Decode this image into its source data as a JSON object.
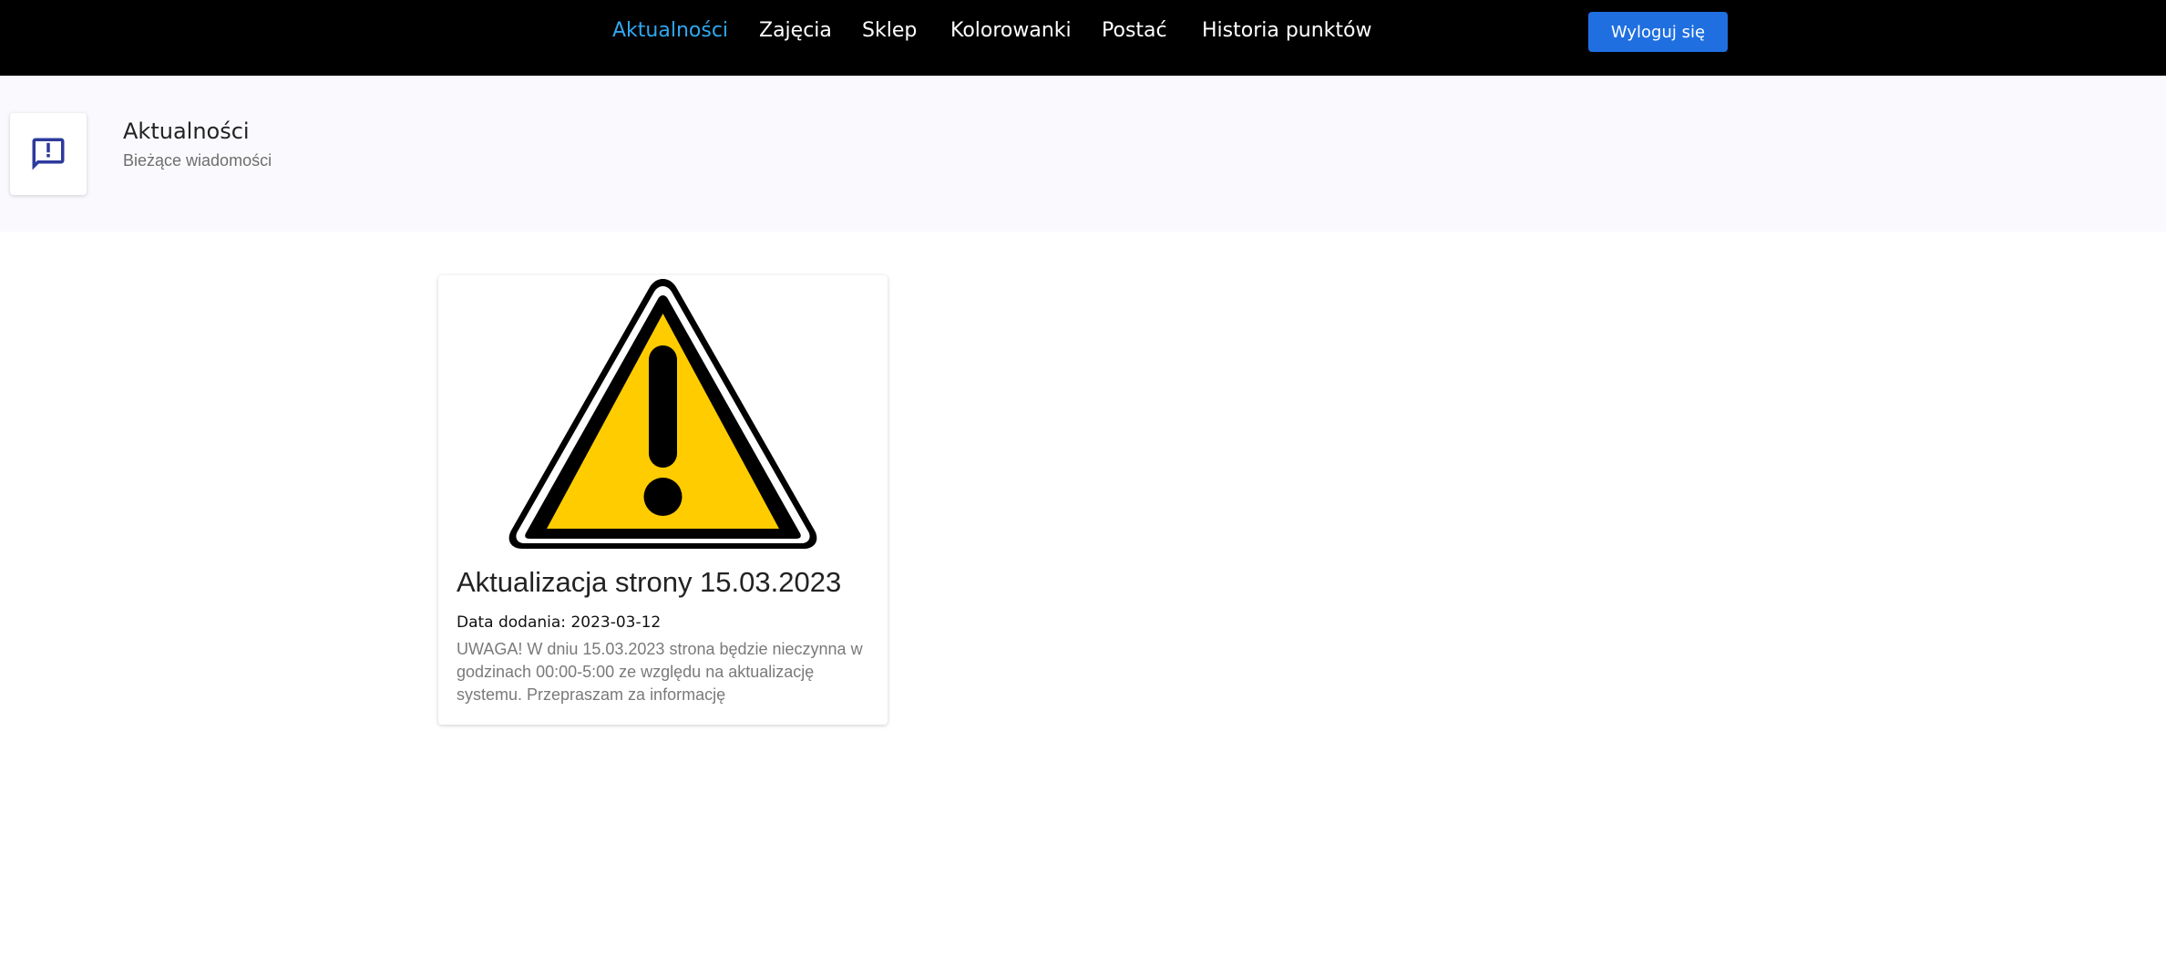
{
  "nav": {
    "items": [
      {
        "label": "Aktualności",
        "active": true
      },
      {
        "label": "Zajęcia",
        "active": false
      },
      {
        "label": "Sklep",
        "active": false
      },
      {
        "label": "Kolorowanki",
        "active": false
      },
      {
        "label": "Postać",
        "active": false
      },
      {
        "label": "Historia punktów",
        "active": false
      }
    ],
    "logout_label": "Wyloguj się"
  },
  "header": {
    "icon": "feedback-exclamation-icon",
    "title": "Aktualności",
    "subtitle": "Bieżące wiadomości"
  },
  "news": [
    {
      "image_icon": "warning-triangle-icon",
      "title": "Aktualizacja strony 15.03.2023",
      "date_line": "Data dodania: 2023-03-12",
      "description": "UWAGA! W dniu 15.03.2023 strona będzie nieczynna w godzinach 00:00-5:00 ze względu na aktualizację systemu. Przepraszam za informację"
    }
  ],
  "colors": {
    "topbar_bg": "#000000",
    "nav_active": "#2fa8f0",
    "button_bg": "#1f6fe0",
    "header_icon": "#2e3a9c",
    "warning_yellow": "#ffcc00"
  }
}
